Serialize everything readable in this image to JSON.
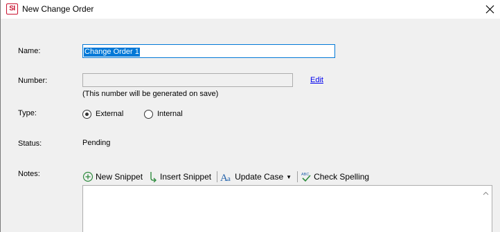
{
  "window": {
    "title": "New Change Order",
    "app_icon_text": "SI"
  },
  "form": {
    "name": {
      "label": "Name:",
      "value": "Change Order 1"
    },
    "number": {
      "label": "Number:",
      "value": "",
      "edit_link": "Edit",
      "hint": "(This number will be generated on save)"
    },
    "type": {
      "label": "Type:",
      "options": [
        {
          "label": "External",
          "selected": true
        },
        {
          "label": "Internal",
          "selected": false
        }
      ]
    },
    "status": {
      "label": "Status:",
      "value": "Pending"
    },
    "notes": {
      "label": "Notes:",
      "toolbar": {
        "new_snippet": "New Snippet",
        "insert_snippet": "Insert Snippet",
        "update_case": "Update Case",
        "check_spelling": "Check Spelling"
      },
      "value": ""
    }
  },
  "colors": {
    "focus_border": "#0078d7",
    "selection": "#0078d7",
    "link": "#0000ee",
    "brand": "#c8102e",
    "icon_green": "#2e8b3e",
    "icon_blue": "#1f5fa8"
  }
}
